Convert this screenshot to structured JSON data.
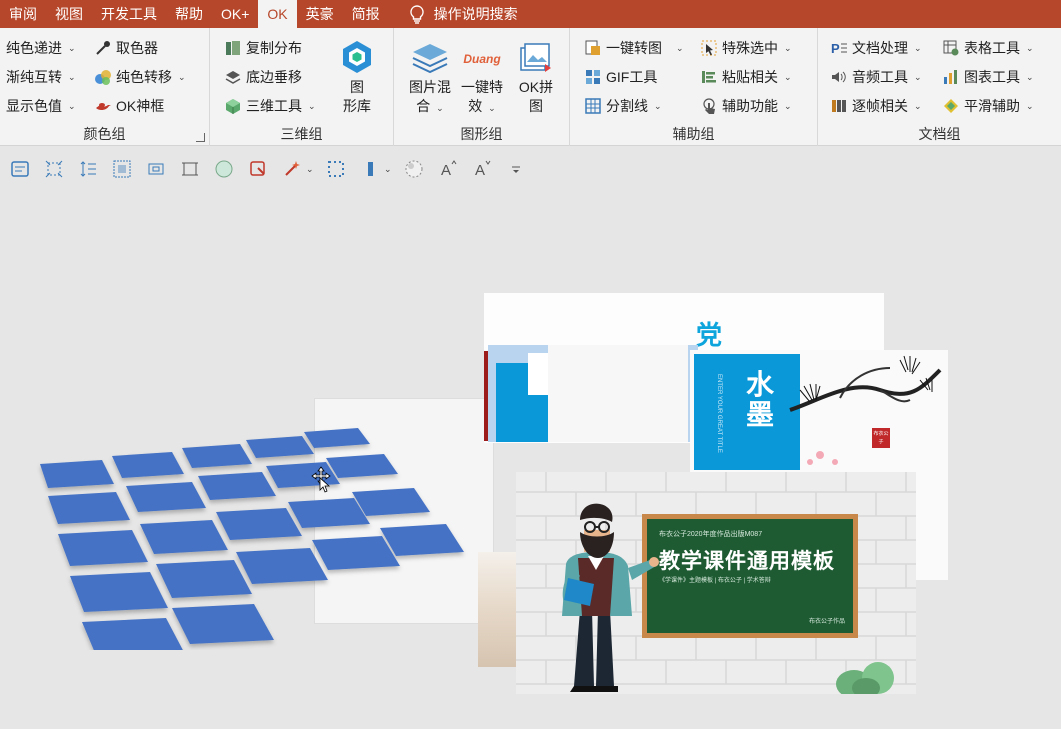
{
  "tabs": [
    {
      "label": "审阅"
    },
    {
      "label": "视图"
    },
    {
      "label": "开发工具"
    },
    {
      "label": "帮助"
    },
    {
      "label": "OK+"
    },
    {
      "label": "OK"
    },
    {
      "label": "英豪"
    },
    {
      "label": "简报"
    }
  ],
  "active_tab": "OK",
  "search_tab": "操作说明搜索",
  "groups": {
    "color": {
      "label": "颜色组",
      "items": [
        "纯色递进",
        "渐纯互转",
        "显示色值",
        "取色器",
        "纯色转移",
        "OK神框"
      ]
    },
    "threed": {
      "label": "三维组",
      "items": [
        "复制分布",
        "底边垂移",
        "三维工具"
      ],
      "big": [
        "图",
        "形库"
      ]
    },
    "shape": {
      "label": "图形组",
      "big1": [
        "图片混",
        "合"
      ],
      "big2": [
        "一键特",
        "效"
      ],
      "big3": [
        "OK拼",
        "图"
      ],
      "duang": "Duang"
    },
    "assist": {
      "label": "辅助组",
      "items": [
        "一键转图",
        "GIF工具",
        "分割线",
        "特殊选中",
        "粘贴相关",
        "辅助功能"
      ]
    },
    "doc": {
      "label": "文档组",
      "items": [
        "文档处理",
        "音频工具",
        "逐帧相关",
        "表格工具",
        "图表工具",
        "平滑辅助"
      ]
    }
  },
  "slides": {
    "party_char": "党",
    "ink_title": "水墨",
    "ink_vertical": "ENTER YOUR GREAT TITLE",
    "seal": "布衣公子",
    "board_top": "布衣公子2020年度作品出版M087",
    "board_title": "教学课件通用模板",
    "board_sub": "《学课件》主题模板 | 布衣公子 | 学术答辩",
    "board_sign": "布衣公子作品"
  },
  "colors": {
    "accent": "#b7472a",
    "tile_blue": "#4472c4",
    "chalk_green": "#1e5b33",
    "party_blue": "#0ea5dd"
  }
}
